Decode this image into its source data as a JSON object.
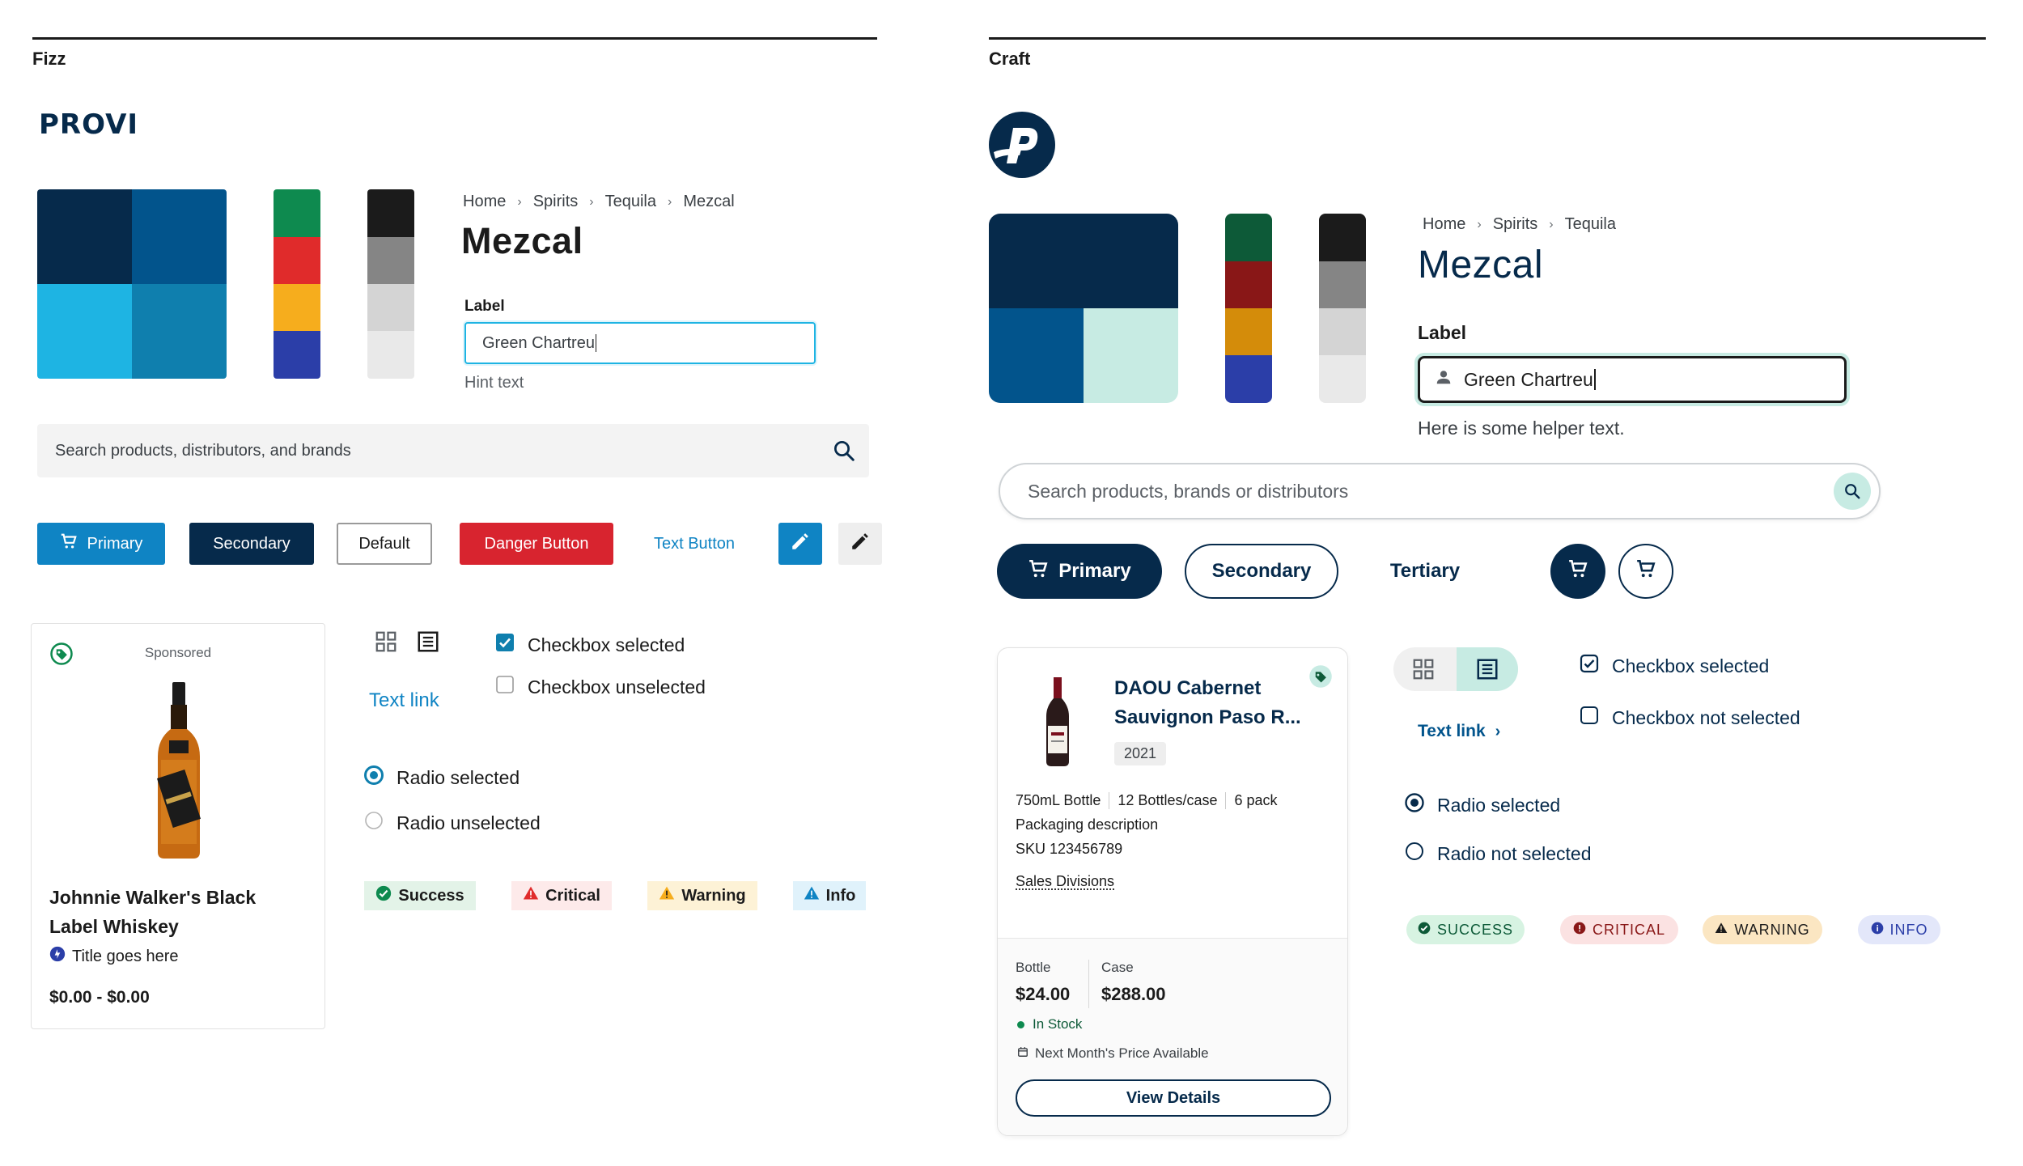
{
  "fizz": {
    "section_title": "Fizz",
    "logo_text": "PROVI",
    "colors": {
      "primary_grid": [
        "#062a4b",
        "#02548c",
        "#1eb4e3",
        "#0f7fae"
      ],
      "status_strip": [
        "#0e8a4f",
        "#e02b2b",
        "#f6ad1d",
        "#2b3ea8"
      ],
      "gray_strip": [
        "#1b1b1b",
        "#858585",
        "#d4d4d4",
        "#e9e9e9"
      ]
    },
    "breadcrumb": [
      "Home",
      "Spirits",
      "Tequila",
      "Mezcal"
    ],
    "page_title": "Mezcal",
    "field": {
      "label": "Label",
      "value": "Green Chartreu",
      "hint": "Hint text"
    },
    "search": {
      "placeholder": "Search products, distributors, and brands"
    },
    "buttons": {
      "primary": "Primary",
      "secondary": "Secondary",
      "default": "Default",
      "danger": "Danger Button",
      "text": "Text Button"
    },
    "product_card": {
      "sponsored": "Sponsored",
      "name_line1": "Johnnie Walker's Black",
      "name_line2": "Label Whiskey",
      "subtitle": "Title goes here",
      "price": "$0.00 - $0.00"
    },
    "text_link": "Text link",
    "checkboxes": {
      "selected": "Checkbox selected",
      "unselected": "Checkbox unselected"
    },
    "radios": {
      "selected": "Radio selected",
      "unselected": "Radio unselected"
    },
    "badges": {
      "success": "Success",
      "critical": "Critical",
      "warning": "Warning",
      "info": "Info"
    }
  },
  "craft": {
    "section_title": "Craft",
    "colors": {
      "primary_grid": [
        "#062a4b",
        "#02548c",
        "#c7ebe3"
      ],
      "status_strip": [
        "#0d5a38",
        "#891717",
        "#d48c0a",
        "#2b3ea8"
      ],
      "gray_strip": [
        "#1b1b1b",
        "#858585",
        "#d4d4d4",
        "#e9e9e9"
      ]
    },
    "breadcrumb": [
      "Home",
      "Spirits",
      "Tequila"
    ],
    "page_title": "Mezcal",
    "field": {
      "label": "Label",
      "value": "Green Chartreu",
      "helper": "Here is some helper text."
    },
    "search": {
      "placeholder": "Search products, brands or distributors"
    },
    "buttons": {
      "primary": "Primary",
      "secondary": "Secondary",
      "tertiary": "Tertiary"
    },
    "product_card": {
      "name_line1": "DAOU Cabernet",
      "name_line2": "Sauvignon Paso R...",
      "year": "2021",
      "specs": [
        "750mL Bottle",
        "12 Bottles/case",
        "6 pack"
      ],
      "packaging": "Packaging description",
      "sku": "SKU 123456789",
      "divisions": "Sales Divisions",
      "bottle_label": "Bottle",
      "case_label": "Case",
      "bottle_price": "$24.00",
      "case_price": "$288.00",
      "stock": "In Stock",
      "next_price": "Next Month's Price Available",
      "cta": "View Details"
    },
    "text_link": "Text link",
    "checkboxes": {
      "selected": "Checkbox selected",
      "unselected": "Checkbox not selected"
    },
    "radios": {
      "selected": "Radio selected",
      "unselected": "Radio not selected"
    },
    "badges": {
      "success": "SUCCESS",
      "critical": "CRITICAL",
      "warning": "WARNING",
      "info": "INFO"
    }
  }
}
